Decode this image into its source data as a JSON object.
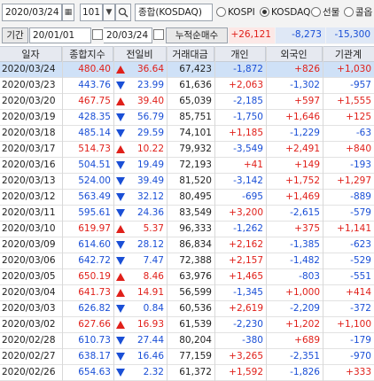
{
  "toolbar": {
    "date": "2020/03/24",
    "code": "101",
    "market_name": "종합(KOSDAQ)",
    "radios": [
      {
        "label": "KOSPI",
        "checked": false
      },
      {
        "label": "KOSDAQ",
        "checked": true
      },
      {
        "label": "선물",
        "checked": false
      },
      {
        "label": "콜옵",
        "checked": false
      }
    ]
  },
  "filter": {
    "period_label": "기간",
    "start_date": "20/01/01",
    "range_sep": "~",
    "end_date": "20/03/24",
    "cumulative_label": "누적순매수",
    "sum_individual": "+26,121",
    "sum_foreign": "-8,273",
    "sum_institution": "-15,300"
  },
  "table": {
    "headers": [
      "일자",
      "종합지수",
      "전일비",
      "거래대금",
      "개인",
      "외국인",
      "기관계"
    ],
    "rows": [
      {
        "date": "2020/03/24",
        "index": "480.40",
        "dir": "up",
        "change": "36.64",
        "amount": "67,423",
        "individual": "-1,872",
        "foreign": "+826",
        "institution": "+1,030"
      },
      {
        "date": "2020/03/23",
        "index": "443.76",
        "dir": "dn",
        "change": "23.99",
        "amount": "61,636",
        "individual": "+2,063",
        "foreign": "-1,302",
        "institution": "-957"
      },
      {
        "date": "2020/03/20",
        "index": "467.75",
        "dir": "up",
        "change": "39.40",
        "amount": "65,039",
        "individual": "-2,185",
        "foreign": "+597",
        "institution": "+1,555"
      },
      {
        "date": "2020/03/19",
        "index": "428.35",
        "dir": "dn",
        "change": "56.79",
        "amount": "85,751",
        "individual": "-1,750",
        "foreign": "+1,646",
        "institution": "+125"
      },
      {
        "date": "2020/03/18",
        "index": "485.14",
        "dir": "dn",
        "change": "29.59",
        "amount": "74,101",
        "individual": "+1,185",
        "foreign": "-1,229",
        "institution": "-63"
      },
      {
        "date": "2020/03/17",
        "index": "514.73",
        "dir": "up",
        "change": "10.22",
        "amount": "79,932",
        "individual": "-3,549",
        "foreign": "+2,491",
        "institution": "+840"
      },
      {
        "date": "2020/03/16",
        "index": "504.51",
        "dir": "dn",
        "change": "19.49",
        "amount": "72,193",
        "individual": "+41",
        "foreign": "+149",
        "institution": "-193"
      },
      {
        "date": "2020/03/13",
        "index": "524.00",
        "dir": "dn",
        "change": "39.49",
        "amount": "81,520",
        "individual": "-3,142",
        "foreign": "+1,752",
        "institution": "+1,297"
      },
      {
        "date": "2020/03/12",
        "index": "563.49",
        "dir": "dn",
        "change": "32.12",
        "amount": "80,495",
        "individual": "-695",
        "foreign": "+1,469",
        "institution": "-889"
      },
      {
        "date": "2020/03/11",
        "index": "595.61",
        "dir": "dn",
        "change": "24.36",
        "amount": "83,549",
        "individual": "+3,200",
        "foreign": "-2,615",
        "institution": "-579"
      },
      {
        "date": "2020/03/10",
        "index": "619.97",
        "dir": "up",
        "change": "5.37",
        "amount": "96,333",
        "individual": "-1,262",
        "foreign": "+375",
        "institution": "+1,141"
      },
      {
        "date": "2020/03/09",
        "index": "614.60",
        "dir": "dn",
        "change": "28.12",
        "amount": "86,834",
        "individual": "+2,162",
        "foreign": "-1,385",
        "institution": "-623"
      },
      {
        "date": "2020/03/06",
        "index": "642.72",
        "dir": "dn",
        "change": "7.47",
        "amount": "72,388",
        "individual": "+2,157",
        "foreign": "-1,482",
        "institution": "-529"
      },
      {
        "date": "2020/03/05",
        "index": "650.19",
        "dir": "up",
        "change": "8.46",
        "amount": "63,976",
        "individual": "+1,465",
        "foreign": "-803",
        "institution": "-551"
      },
      {
        "date": "2020/03/04",
        "index": "641.73",
        "dir": "up",
        "change": "14.91",
        "amount": "56,599",
        "individual": "-1,345",
        "foreign": "+1,000",
        "institution": "+414"
      },
      {
        "date": "2020/03/03",
        "index": "626.82",
        "dir": "dn",
        "change": "0.84",
        "amount": "60,536",
        "individual": "+2,619",
        "foreign": "-2,209",
        "institution": "-372"
      },
      {
        "date": "2020/03/02",
        "index": "627.66",
        "dir": "up",
        "change": "16.93",
        "amount": "61,539",
        "individual": "-2,230",
        "foreign": "+1,202",
        "institution": "+1,100"
      },
      {
        "date": "2020/02/28",
        "index": "610.73",
        "dir": "dn",
        "change": "27.44",
        "amount": "80,204",
        "individual": "-380",
        "foreign": "+689",
        "institution": "-179"
      },
      {
        "date": "2020/02/27",
        "index": "638.17",
        "dir": "dn",
        "change": "16.46",
        "amount": "77,159",
        "individual": "+3,265",
        "foreign": "-2,351",
        "institution": "-970"
      },
      {
        "date": "2020/02/26",
        "index": "654.63",
        "dir": "dn",
        "change": "2.32",
        "amount": "61,372",
        "individual": "+1,592",
        "foreign": "-1,826",
        "institution": "+333"
      }
    ]
  },
  "colors": {
    "up": "#e0201a",
    "down": "#1a4fd6",
    "selected_row": "#cfe1f7",
    "header": "#e6e9f0"
  }
}
